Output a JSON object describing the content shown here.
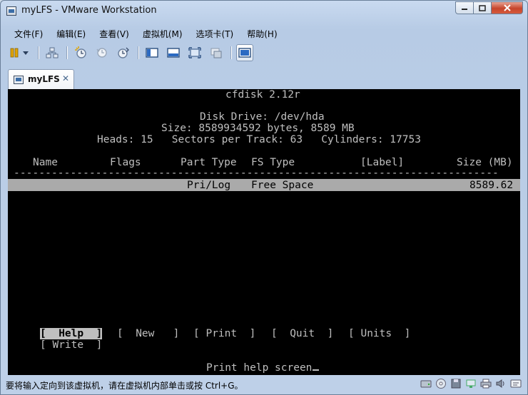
{
  "window": {
    "title": "myLFS - VMware Workstation"
  },
  "menubar": {
    "items": [
      "文件(F)",
      "编辑(E)",
      "查看(V)",
      "虚拟机(M)",
      "选项卡(T)",
      "帮助(H)"
    ]
  },
  "tab": {
    "label": "myLFS",
    "close": "✕"
  },
  "console": {
    "header": "cfdisk 2.12r",
    "disk_drive": "Disk Drive: /dev/hda",
    "size": "Size: 8589934592 bytes, 8589 MB",
    "geometry": "Heads: 15   Sectors per Track: 63   Cylinders: 17753",
    "columns": {
      "name": "Name",
      "flags": "Flags",
      "part_type": "Part Type",
      "fs_type": "FS Type",
      "label": "[Label]",
      "size": "Size (MB)"
    },
    "separator": "-----------------------------------------------------------------------------",
    "row": {
      "part_type": "Pri/Log",
      "fs_type": "Free Space",
      "size": "8589.62"
    },
    "commands": {
      "help": "[  Help  ]",
      "new": "[  New   ]",
      "print": "[ Print  ]",
      "quit": "[  Quit  ]",
      "units": "[ Units  ]",
      "write": "[ Write  ]"
    },
    "prompt": "Print help screen"
  },
  "statusbar": {
    "text": "要将输入定向到该虚拟机，请在虚拟机内部单击或按 Ctrl+G。"
  },
  "colors": {
    "console_bg": "#000000",
    "console_fg": "#bfbfbf",
    "highlight_bg": "#aaaaaa",
    "close_button": "#c6452c"
  }
}
